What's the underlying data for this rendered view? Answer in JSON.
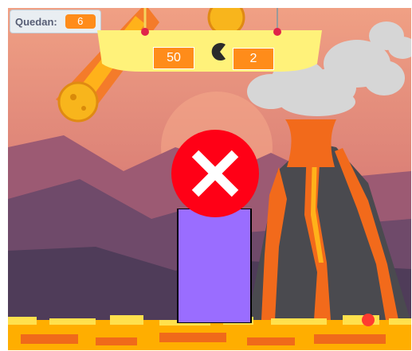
{
  "variable_monitor": {
    "label": "Quedan:",
    "value": "6"
  },
  "sign": {
    "left_value": "50",
    "right_value": "2",
    "operator_icon": "pacman-less-than-icon"
  },
  "feedback": {
    "icon": "wrong-cross-icon",
    "state": "incorrect"
  },
  "colors": {
    "sky_top": "#f0a084",
    "sky_bottom": "#b85a70",
    "lava": "#ffae00",
    "bar": "#9a6dff",
    "feedback_red": "#ff0016",
    "monitor_value": "#ff8c1a",
    "sign": "#fff27a"
  }
}
